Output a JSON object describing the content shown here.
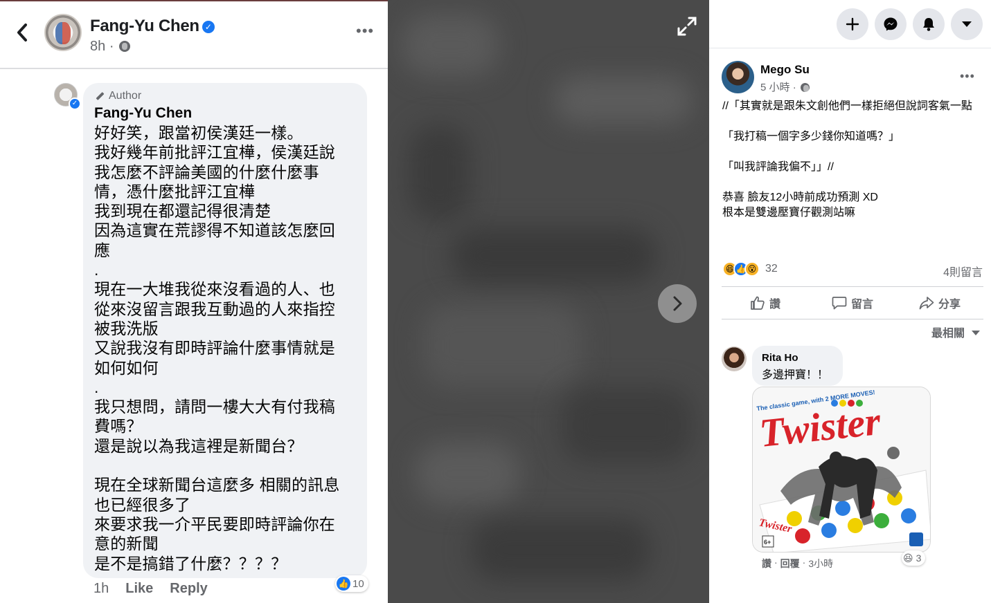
{
  "left_post": {
    "author_name": "Fang-Yu Chen",
    "time": "8h",
    "meta_separator": "·"
  },
  "comment": {
    "author_tag": "Author",
    "author_name": "Fang-Yu Chen",
    "body": "好好笑，跟當初侯漢廷一樣。\n我好幾年前批評江宜樺，侯漢廷說\n我怎麼不評論美國的什麼什麼事\n情，憑什麼批評江宜樺\n我到現在都還記得很清楚\n因為這實在荒謬得不知道該怎麼回\n應\n.\n現在一大堆我從來沒看過的人、也\n從來沒留言跟我互動過的人來指控\n被我洗版\n又說我沒有即時評論什麼事情就是\n如何如何\n.\n我只想問，請問一樓大大有付我稿\n費嗎？\n還是說以為我這裡是新聞台？\n\n現在全球新聞台這麼多 相關的訊息\n也已經很多了\n來要求我一介平民要即時評論你在\n意的新聞\n是不是搞錯了什麼？？？？",
    "like_count": "10",
    "time": "1h",
    "like_label": "Like",
    "reply_label": "Reply"
  },
  "post": {
    "author_name": "Mego Su",
    "time": "5 小時",
    "meta_separator": "·",
    "text": "//「其實就是跟朱文創他們一樣拒絕但說詞客氣一點\n\n「我打稿一個字多少錢你知道嗎？」\n\n「叫我評論我偏不」」//\n\n恭喜 臉友12小時前成功預測 XD\n根本是雙邊壓寶仔觀測站嘛",
    "reaction_count": "32",
    "comment_count": "4則留言",
    "like_label": "讚",
    "comment_label": "留言",
    "share_label": "分享",
    "sort_label": "最相關"
  },
  "reply": {
    "author_name": "Rita Ho",
    "text": "多邊押寶！！",
    "reaction_count": "3",
    "like_label": "讚",
    "dot": "·",
    "reply_label": "回覆",
    "time": "3小時"
  },
  "sticker": {
    "tagline": "The classic game, with 2 MORE MOVES!",
    "title": "Twister",
    "box_title": "Twister",
    "age": "6+"
  },
  "colors": {
    "accent": "#1877f2",
    "secondary_text": "#65676b",
    "bubble_bg": "#f0f2f5",
    "twister_red": "#d8232a"
  }
}
